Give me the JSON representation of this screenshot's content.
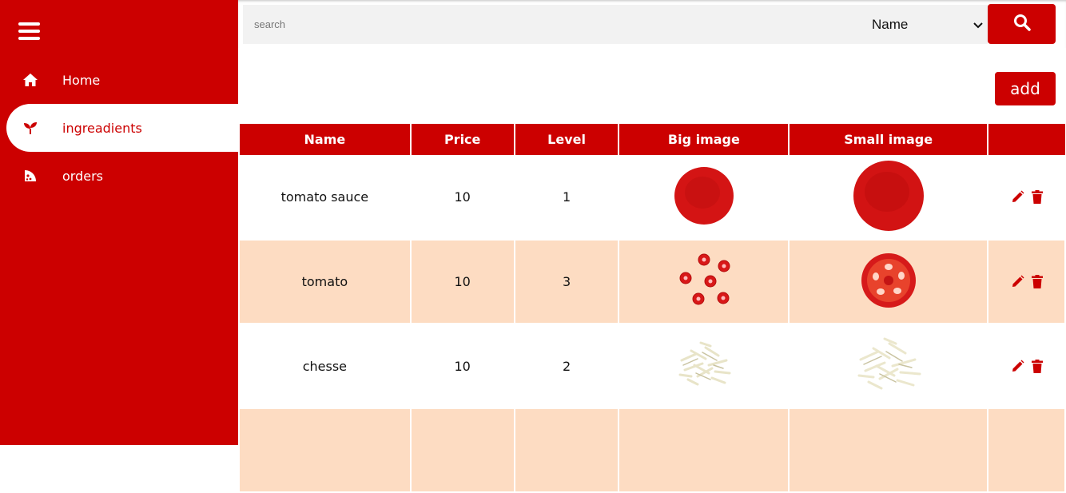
{
  "sidebar": {
    "items": [
      {
        "label": "Home",
        "icon": "home-icon"
      },
      {
        "label": "ingreadients",
        "icon": "sprout-icon",
        "active": true
      },
      {
        "label": "orders",
        "icon": "pizza-icon"
      }
    ]
  },
  "search": {
    "placeholder": "search",
    "value": "",
    "select_value": "Name"
  },
  "toolbar": {
    "add_label": "add"
  },
  "table": {
    "headers": [
      "Name",
      "Price",
      "Level",
      "Big image",
      "Small image",
      ""
    ],
    "rows": [
      {
        "name": "tomato sauce",
        "price": "10",
        "level": "1",
        "image": "tomato-sauce-image"
      },
      {
        "name": "tomato",
        "price": "10",
        "level": "3",
        "image": "tomato-image"
      },
      {
        "name": "chesse",
        "price": "10",
        "level": "2",
        "image": "cheese-image"
      },
      {
        "name": "",
        "price": "",
        "level": "",
        "image": "partial-row-image"
      }
    ]
  },
  "colors": {
    "brand": "#cc0000",
    "row_alt": "#fddcc2"
  }
}
